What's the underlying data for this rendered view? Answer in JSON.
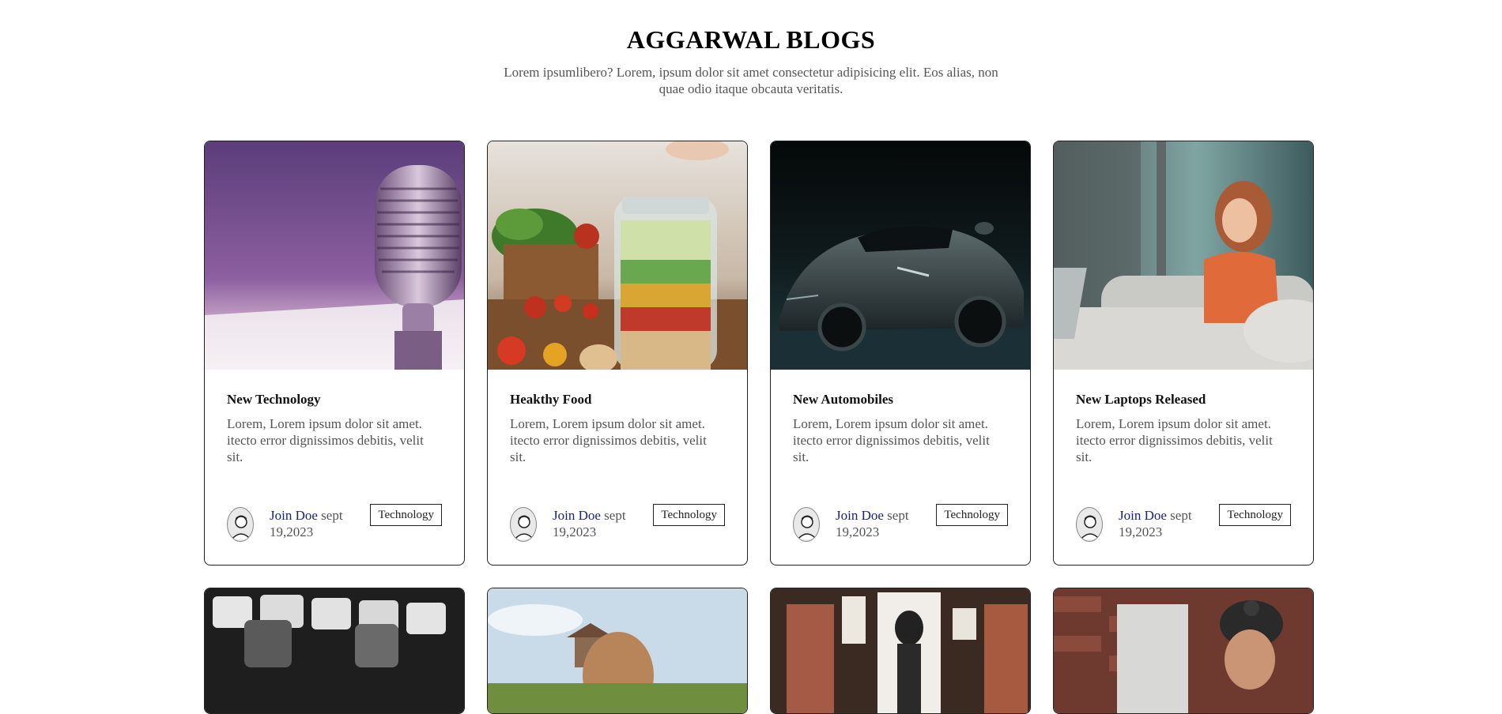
{
  "header": {
    "title": "AGGARWAL BLOGS",
    "description": "Lorem ipsumlibero? Lorem, ipsum dolor sit amet consectetur adipisicing elit. Eos alias, non quae odio itaque obcauta veritatis."
  },
  "cards": [
    {
      "image": "microphone-image",
      "title": "New Technology",
      "text": "Lorem, Lorem ipsum dolor sit amet. itecto error dignissimos debitis, velit sit.",
      "author": "Join Doe",
      "date_a": "sept",
      "date_b": "19,2023",
      "tag": "Technology"
    },
    {
      "image": "salad-jar-image",
      "title": "Heakthy Food",
      "text": "Lorem, Lorem ipsum dolor sit amet. itecto error dignissimos debitis, velit sit.",
      "author": "Join Doe",
      "date_a": "sept",
      "date_b": "19,2023",
      "tag": "Technology"
    },
    {
      "image": "sports-car-image",
      "title": "New Automobiles",
      "text": "Lorem, Lorem ipsum dolor sit amet. itecto error dignissimos debitis, velit sit.",
      "author": "Join Doe",
      "date_a": "sept",
      "date_b": "19,2023",
      "tag": "Technology"
    },
    {
      "image": "woman-laptop-image",
      "title": "New Laptops Released",
      "text": "Lorem, Lorem ipsum dolor sit amet. itecto error dignissimos debitis, velit sit.",
      "author": "Join Doe",
      "date_a": "sept",
      "date_b": "19,2023",
      "tag": "Technology"
    }
  ],
  "colors": {
    "author_link": "#1a237e",
    "border": "#222222",
    "muted_text": "#555555"
  }
}
